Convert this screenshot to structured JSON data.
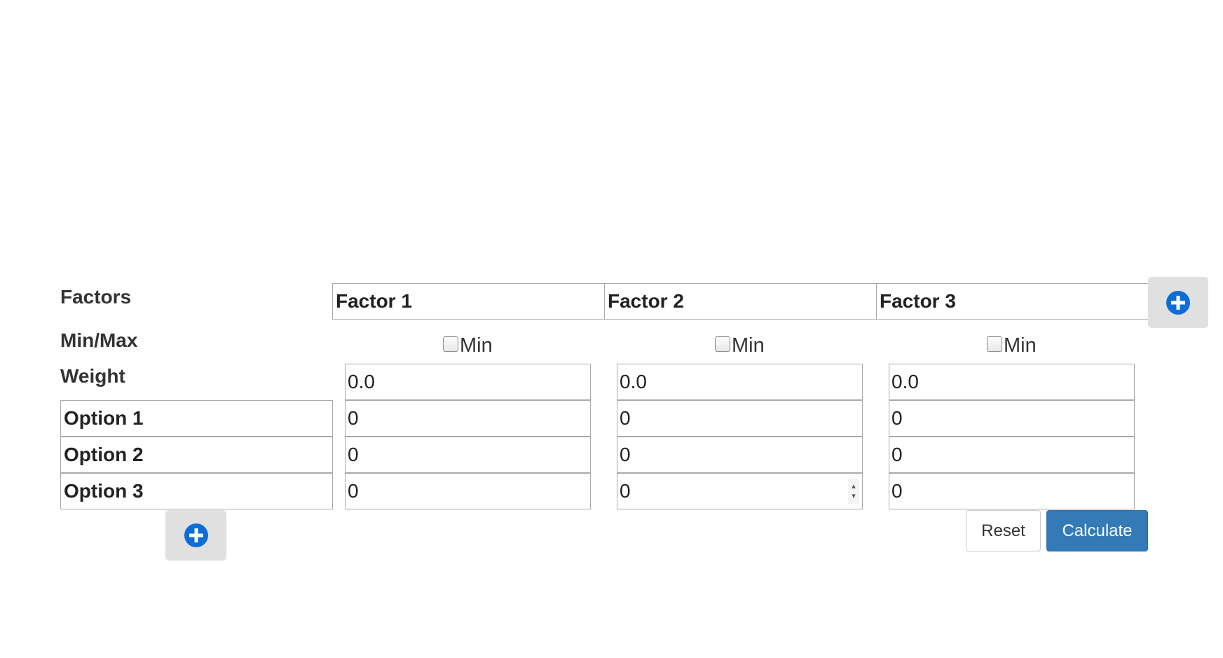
{
  "labels": {
    "factors": "Factors",
    "minmax": "Min/Max",
    "weight": "Weight"
  },
  "factors": [
    {
      "name": "Factor 1",
      "min_label": "Min",
      "min_checked": false,
      "weight": "0.0"
    },
    {
      "name": "Factor 2",
      "min_label": "Min",
      "min_checked": false,
      "weight": "0.0"
    },
    {
      "name": "Factor 3",
      "min_label": "Min",
      "min_checked": false,
      "weight": "0.0"
    }
  ],
  "options": [
    {
      "name": "Option 1",
      "scores": [
        "0",
        "0",
        "0"
      ]
    },
    {
      "name": "Option 2",
      "scores": [
        "0",
        "0",
        "0"
      ]
    },
    {
      "name": "Option 3",
      "scores": [
        "0",
        "0",
        "0"
      ]
    }
  ],
  "buttons": {
    "reset": "Reset",
    "calculate": "Calculate"
  },
  "icons": {
    "add_factor": "plus-circle-icon",
    "add_option": "plus-circle-icon"
  },
  "colors": {
    "accent": "#337ab7",
    "plus_icon": "#0d6cd6",
    "add_button_bg": "#e0e0e0"
  }
}
